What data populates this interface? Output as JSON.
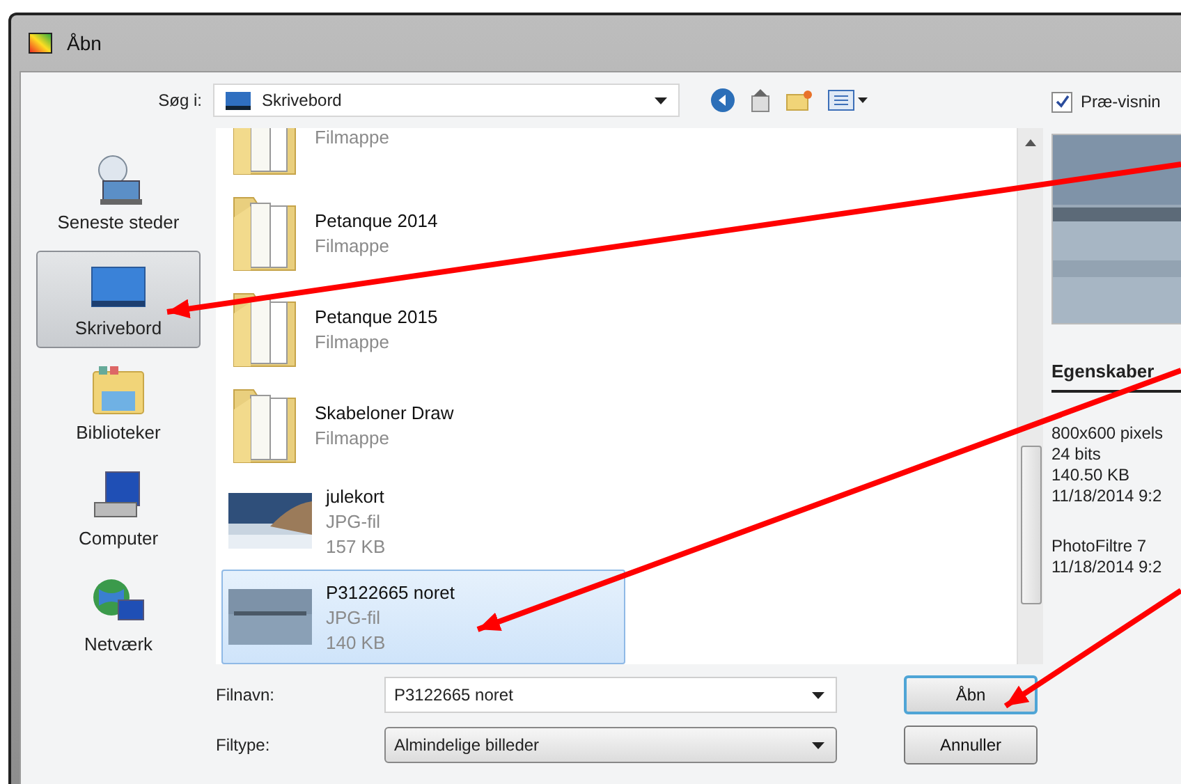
{
  "window": {
    "title": "Åbn"
  },
  "toolbar": {
    "look_in_label": "Søg i:",
    "location": "Skrivebord"
  },
  "preview_toggle": {
    "label": "Præ-visnin",
    "checked": true
  },
  "places": [
    {
      "label": "Seneste steder",
      "kind": "recent",
      "selected": false
    },
    {
      "label": "Skrivebord",
      "kind": "desktop",
      "selected": true
    },
    {
      "label": "Biblioteker",
      "kind": "library",
      "selected": false
    },
    {
      "label": "Computer",
      "kind": "computer",
      "selected": false
    },
    {
      "label": "Netværk",
      "kind": "network",
      "selected": false
    }
  ],
  "files": [
    {
      "type": "Filmappe",
      "kind": "folder",
      "selected": false
    },
    {
      "name": "Petanque 2014",
      "type": "Filmappe",
      "kind": "folder",
      "selected": false
    },
    {
      "name": "Petanque 2015",
      "type": "Filmappe",
      "kind": "folder",
      "selected": false
    },
    {
      "name": "Skabeloner Draw",
      "type": "Filmappe",
      "kind": "folder",
      "selected": false
    },
    {
      "name": "julekort",
      "type": "JPG-fil",
      "size": "157 KB",
      "selected": false
    },
    {
      "name": "P3122665 noret",
      "type": "JPG-fil",
      "size": "140 KB",
      "selected": true
    }
  ],
  "properties": {
    "heading": "Egenskaber",
    "groups": [
      [
        "800x600 pixels",
        "24 bits",
        "140.50 KB",
        "11/18/2014 9:2"
      ],
      [
        "PhotoFiltre 7",
        "11/18/2014 9:2"
      ]
    ]
  },
  "filename": {
    "label": "Filnavn:",
    "value": "P3122665 noret"
  },
  "filetype": {
    "label": "Filtype:",
    "value": "Almindelige billeder"
  },
  "buttons": [
    {
      "label": "Åbn",
      "kind": "primary"
    },
    {
      "label": "Annuller",
      "kind": "secondary"
    }
  ]
}
